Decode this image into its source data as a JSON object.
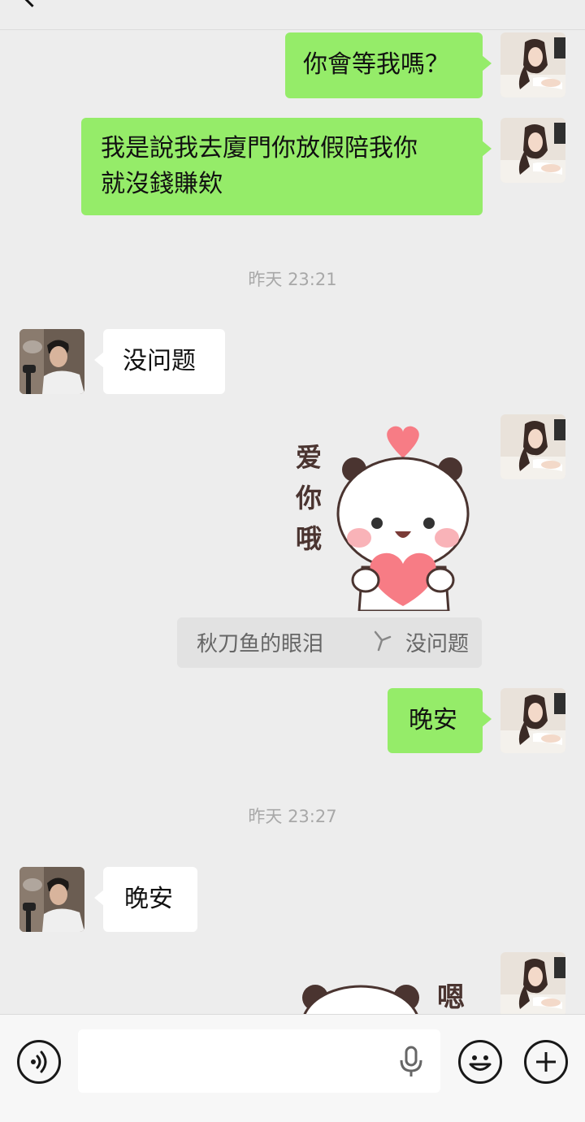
{
  "header": {
    "title_fragment": ""
  },
  "messages": {
    "m1": {
      "text": "你會等我嗎？"
    },
    "m2": {
      "line1": "我是說我去廈門你放假陪我你",
      "line2": "就沒錢賺欸"
    },
    "t1": {
      "text": "昨天 23:21"
    },
    "m3": {
      "text": "没问题"
    },
    "sticker1": {
      "lines": [
        "爱",
        "你",
        "哦"
      ]
    },
    "quote": {
      "name": "秋刀鱼的眼泪",
      "text": "没问题"
    },
    "m4": {
      "text": "晚安"
    },
    "t2": {
      "text": "昨天 23:27"
    },
    "m5": {
      "text": "晚安"
    },
    "sticker2": {
      "text": "嗯"
    }
  },
  "input_bar": {
    "voice_icon": "voice-toggle-icon",
    "mic_icon": "microphone-icon",
    "emoji_icon": "emoji-icon",
    "plus_icon": "plus-icon"
  },
  "colors": {
    "my_bubble": "#95ec69",
    "their_bubble": "#ffffff",
    "background": "#ededed",
    "sticker_heart": "#f77c85"
  }
}
